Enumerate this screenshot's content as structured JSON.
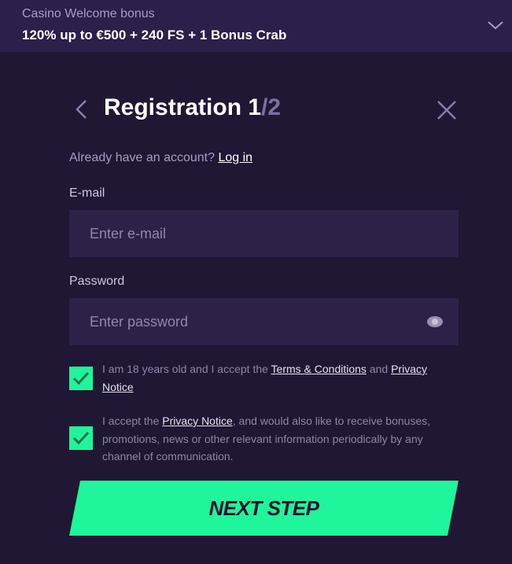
{
  "bonus": {
    "subtitle": "Casino Welcome bonus",
    "offer": "120% up to €500 + 240 FS + 1 Bonus Crab"
  },
  "registration": {
    "title": "Registration",
    "step_current": "1",
    "step_total": "/2",
    "already_text": "Already have an account?",
    "login_link": "Log in",
    "email_label": "E-mail",
    "email_placeholder": "Enter e-mail",
    "email_value": "",
    "password_label": "Password",
    "password_placeholder": "Enter password",
    "password_value": ""
  },
  "consents": [
    {
      "checked": true,
      "text_before": "I am 18 years old and I accept the ",
      "link1": "Terms & Conditions",
      "text_mid": " and ",
      "link2": "Privacy Notice"
    },
    {
      "checked": true,
      "text_before": "I accept the ",
      "link1": "Privacy Notice",
      "text_after": ", and would also like to receive bonuses, promotions, news or other relevant information periodically by any channel of communication."
    }
  ],
  "next_button_label": "NEXT STEP",
  "colors": {
    "accent": "#1ff59a",
    "background": "#1d1530",
    "header": "#2c1f4a",
    "input": "#2d2148"
  },
  "icons": [
    "chevron-down-icon",
    "back-arrow-icon",
    "close-icon",
    "eye-icon",
    "checkmark-icon"
  ]
}
